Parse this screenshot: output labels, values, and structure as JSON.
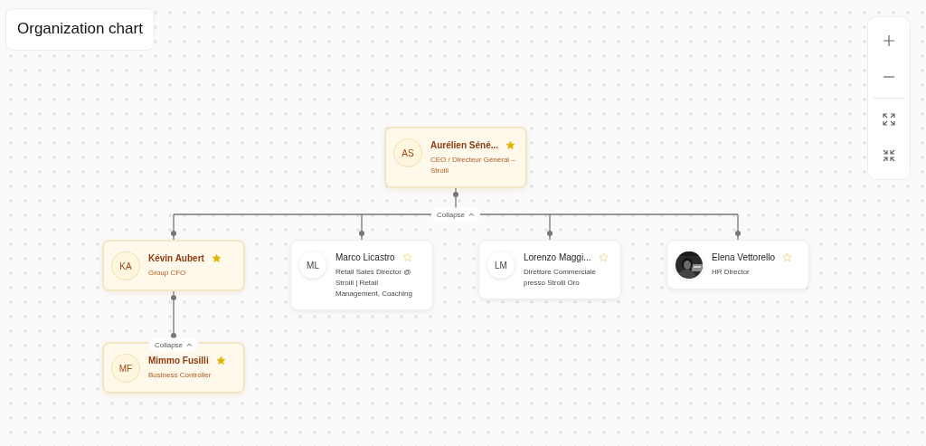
{
  "header": {
    "title": "Organization chart"
  },
  "zoom_controls": [
    {
      "kind": "zoom-in"
    },
    {
      "kind": "zoom-out"
    },
    {
      "kind": "fit"
    },
    {
      "kind": "shrink"
    }
  ],
  "org_chart": {
    "root": {
      "initials": "AS",
      "name": "Aurélien Séné...",
      "title": "CEO / Directeur Général – Stroili",
      "starred": true,
      "expanded": true,
      "toggle_label": "Collapse",
      "children": [
        {
          "initials": "KA",
          "name": "Kévin Aubert",
          "title": "Group CFO",
          "starred": true,
          "expanded": true,
          "toggle_label": "Collapse",
          "children": [
            {
              "initials": "MF",
              "name": "Mimmo Fusilli",
              "title": "Business Controller",
              "starred": true
            }
          ]
        },
        {
          "initials": "ML",
          "name": "Marco Licastro",
          "title": "Retail Sales Director @ Stroili | Retail Management, Coaching",
          "starred": false
        },
        {
          "initials": "LM",
          "name": "Lorenzo Maggi...",
          "title": "Direttore Commerciale presso Stroili Oro",
          "starred": false
        },
        {
          "name": "Elena Vettorello",
          "title": "HR Director",
          "starred": false
        }
      ]
    }
  }
}
